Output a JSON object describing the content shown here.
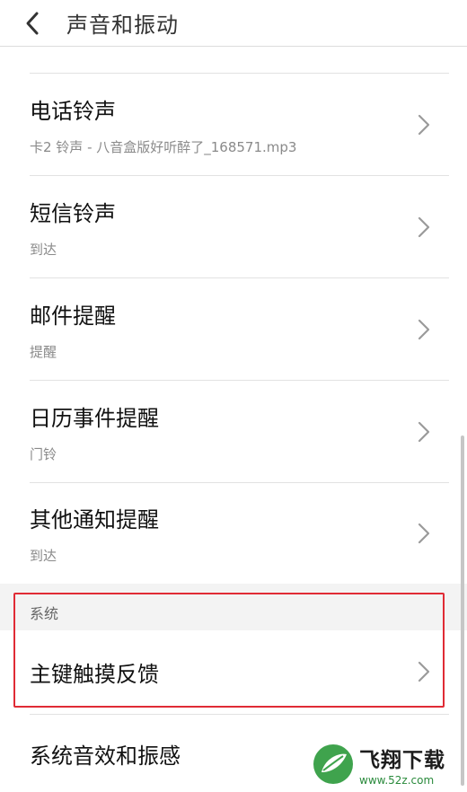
{
  "header": {
    "title": "声音和振动"
  },
  "items": [
    {
      "title": "电话铃声",
      "subtitle": "卡2 铃声 - 八音盒版好听醉了_168571.mp3"
    },
    {
      "title": "短信铃声",
      "subtitle": "到达"
    },
    {
      "title": "邮件提醒",
      "subtitle": "提醒"
    },
    {
      "title": "日历事件提醒",
      "subtitle": "门铃"
    },
    {
      "title": "其他通知提醒",
      "subtitle": "到达"
    }
  ],
  "system_section": {
    "header": "系统",
    "items": [
      {
        "title": "主键触摸反馈"
      },
      {
        "title": "系统音效和振感"
      }
    ]
  },
  "watermark": {
    "brand": "飞翔下载",
    "url": "www.52z.com"
  },
  "colors": {
    "highlight": "#e02b35",
    "section_bg": "#f3f3f3",
    "subtitle": "#8a8a8a",
    "watermark_green": "#2a8a3c"
  }
}
